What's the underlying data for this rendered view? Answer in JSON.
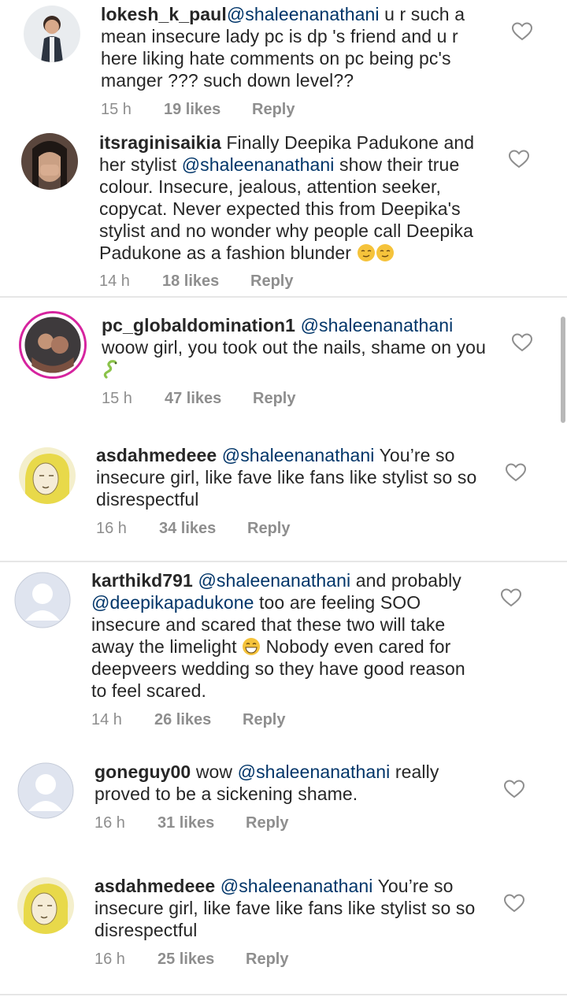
{
  "comments": [
    {
      "username": "lokesh_k_paul",
      "parts": [
        {
          "t": "mention",
          "v": "@shaleenanathani"
        },
        {
          "t": "text",
          "v": " u r such a mean insecure  lady  pc  is dp 's friend and u r here liking hate comments on pc being pc's manger ??? such down level??"
        }
      ],
      "time": "15 h",
      "likes": "19 likes",
      "reply": "Reply",
      "avatar": "avatar-man-standing"
    },
    {
      "username": "itsraginisaikia",
      "parts": [
        {
          "t": "text",
          "v": " Finally Deepika Padukone and her stylist "
        },
        {
          "t": "mention",
          "v": "@shaleenanathani"
        },
        {
          "t": "text",
          "v": " show their true colour. Insecure, jealous, attention seeker, copycat. Never expected this from Deepika's stylist and no wonder why people call Deepika Padukone as a fashion blunder "
        },
        {
          "t": "emoji",
          "v": "smirk-emoji"
        },
        {
          "t": "emoji",
          "v": "smirk-emoji"
        }
      ],
      "time": "14 h",
      "likes": "18 likes",
      "reply": "Reply",
      "avatar": "avatar-woman-laughing"
    },
    {
      "username": "pc_globaldomination1",
      "parts": [
        {
          "t": "text",
          "v": " "
        },
        {
          "t": "mention",
          "v": "@shaleenanathani"
        },
        {
          "t": "text",
          "v": " woow girl, you took out the nails,  shame on you "
        },
        {
          "t": "emoji",
          "v": "snake-emoji"
        }
      ],
      "time": "15 h",
      "likes": "47 likes",
      "reply": "Reply",
      "avatar": "avatar-couple-story"
    },
    {
      "username": "asdahmedeee",
      "parts": [
        {
          "t": "text",
          "v": " "
        },
        {
          "t": "mention",
          "v": "@shaleenanathani"
        },
        {
          "t": "text",
          "v": "  You’re so insecure girl, like fave like fans like stylist so so disrespectful"
        }
      ],
      "time": "16 h",
      "likes": "34 likes",
      "reply": "Reply",
      "avatar": "avatar-hijab-sketch"
    },
    {
      "username": "karthikd791",
      "parts": [
        {
          "t": "text",
          "v": " "
        },
        {
          "t": "mention",
          "v": "@shaleenanathani"
        },
        {
          "t": "text",
          "v": " and probably "
        },
        {
          "t": "mention",
          "v": "@deepikapadukone"
        },
        {
          "t": "text",
          "v": " too are feeling SOO insecure and scared that these two will take away the limelight "
        },
        {
          "t": "emoji",
          "v": "grin-emoji"
        },
        {
          "t": "text",
          "v": " Nobody even cared for deepveers wedding so they have good reason to feel scared."
        }
      ],
      "time": "14 h",
      "likes": "26 likes",
      "reply": "Reply",
      "avatar": "avatar-default"
    },
    {
      "username": "goneguy00",
      "parts": [
        {
          "t": "text",
          "v": " wow "
        },
        {
          "t": "mention",
          "v": "@shaleenanathani"
        },
        {
          "t": "text",
          "v": " really proved to be a sickening shame."
        }
      ],
      "time": "16 h",
      "likes": "31 likes",
      "reply": "Reply",
      "avatar": "avatar-default"
    },
    {
      "username": "asdahmedeee",
      "parts": [
        {
          "t": "text",
          "v": " "
        },
        {
          "t": "mention",
          "v": "@shaleenanathani"
        },
        {
          "t": "text",
          "v": "  You’re so insecure girl, like fave like fans like stylist so so disrespectful"
        }
      ],
      "time": "16 h",
      "likes": "25 likes",
      "reply": "Reply",
      "avatar": "avatar-hijab-sketch"
    }
  ],
  "colors": {
    "mention": "#003569",
    "meta": "#8e8e8e",
    "text": "#262626"
  }
}
